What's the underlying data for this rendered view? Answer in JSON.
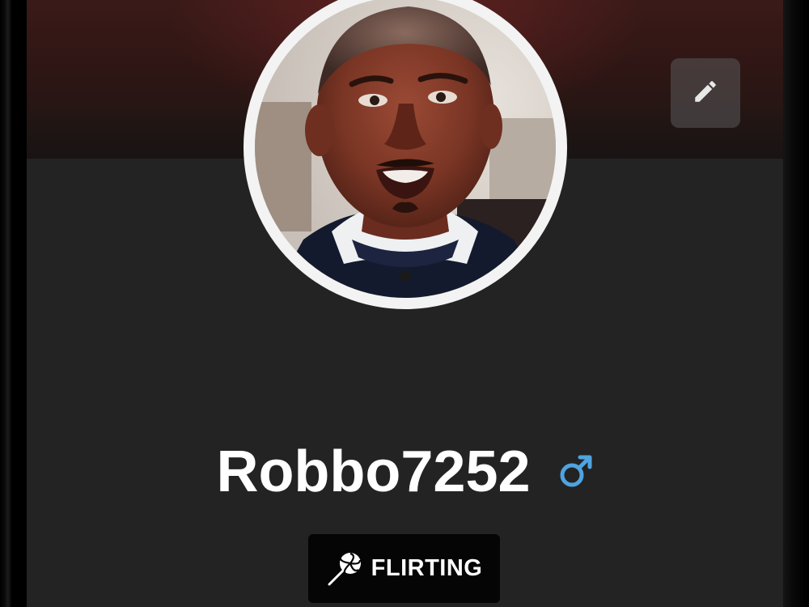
{
  "profile": {
    "username": "Robbo7252",
    "gender_icon": "male-symbol-icon",
    "avatar_alt": "profile-photo",
    "status": {
      "label": "FLIRTING",
      "icon": "lollipop-icon"
    }
  },
  "actions": {
    "edit_icon": "pencil-icon"
  },
  "colors": {
    "screen_background": "#232323",
    "cover_top": "#3a1a18",
    "accent_male": "#4fa3e0",
    "pill_background": "#050505",
    "text_primary": "#ffffff"
  }
}
